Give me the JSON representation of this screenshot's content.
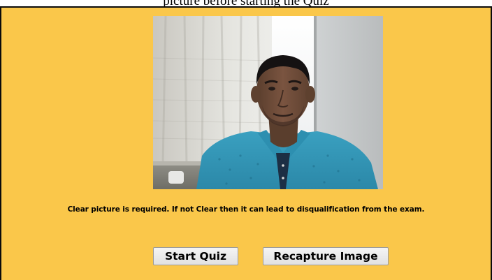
{
  "page": {
    "top_caption": "picture before starting the Quiz"
  },
  "webcam": {
    "image_label": "webcam-capture-preview"
  },
  "notice": {
    "text": "Clear picture is required. If not Clear then it can lead to disqualification from the exam."
  },
  "actions": {
    "start_label": "Start Quiz",
    "recapture_label": "Recapture Image"
  },
  "colors": {
    "panel_background": "#fac74a",
    "panel_border": "#0b0b0b",
    "button_background": "#ececec"
  }
}
